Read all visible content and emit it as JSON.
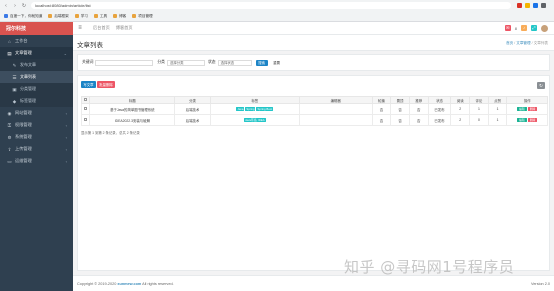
{
  "browser": {
    "url": "localhost:8080/admin/article/list",
    "bookmarks": [
      {
        "label": "百度一下，你就知道",
        "color": "#3b79e6"
      },
      {
        "label": "后端框架",
        "color": "#e8a33d"
      },
      {
        "label": "学习",
        "color": "#e8a33d"
      },
      {
        "label": "工具",
        "color": "#e8a33d"
      },
      {
        "label": "博客",
        "color": "#e8a33d"
      },
      {
        "label": "项目管理",
        "color": "#e8a33d"
      }
    ],
    "ext_colors": [
      "#d93025",
      "#f4b400",
      "#1a73e8",
      "#5f6368"
    ]
  },
  "sidebar": {
    "brand": "冠尔科技",
    "items": [
      {
        "label": "工作台",
        "icon": "home-icon",
        "glyph": "⌂"
      },
      {
        "label": "文章管理",
        "icon": "doc-icon",
        "glyph": "▤",
        "active": true
      },
      {
        "label": "发布文章",
        "icon": "edit-icon",
        "glyph": "✎",
        "sub": true
      },
      {
        "label": "文章列表",
        "icon": "list-icon",
        "glyph": "☰",
        "sub": true,
        "current": true
      },
      {
        "label": "分类管理",
        "icon": "folder-icon",
        "glyph": "▣",
        "sub": true
      },
      {
        "label": "标签管理",
        "icon": "tag-icon",
        "glyph": "◆",
        "sub": true
      },
      {
        "label": "网站管理",
        "icon": "globe-icon",
        "glyph": "◉"
      },
      {
        "label": "权限管理",
        "icon": "lock-icon",
        "glyph": "⚿"
      },
      {
        "label": "系统管理",
        "icon": "gear-icon",
        "glyph": "⚙"
      },
      {
        "label": "上传管理",
        "icon": "upload-icon",
        "glyph": "⇪"
      },
      {
        "label": "运维管理",
        "icon": "monitor-icon",
        "glyph": "▭"
      }
    ]
  },
  "topnav": {
    "tabs": [
      "后台首页",
      "博客首页"
    ],
    "badge_count": "8"
  },
  "page": {
    "title": "文章列表",
    "breadcrumb": [
      "首页",
      "文章管理",
      "文章列表"
    ]
  },
  "search": {
    "keyword_label": "关键词",
    "keyword_placeholder": "",
    "category_label": "分类",
    "category_value": "选择分类",
    "status_label": "状态",
    "status_value": "选择状态",
    "search_btn": "搜索",
    "reset_btn": "重置"
  },
  "toolbar": {
    "write_btn": "写文章",
    "batch_delete_btn": "批量删除"
  },
  "table": {
    "headers": [
      "",
      "标题",
      "分类",
      "标签",
      "编辑器",
      "轮播",
      "置顶",
      "推荐",
      "状态",
      "阅读",
      "评论",
      "点赞",
      "操作"
    ],
    "rows": [
      {
        "title": "基于Java的简单图书管理系统",
        "category": "后端技术",
        "tags": [
          "Java",
          "Spring",
          "Spring Boot"
        ],
        "editor": "",
        "carousel": "否",
        "top": "否",
        "recommend": "否",
        "status": "已发布",
        "reads": "2",
        "comments": "1",
        "likes": "1"
      },
      {
        "title": "IDEA2022.3安装与破解",
        "category": "后端技术",
        "tags": [
          "Java环境, IDEA"
        ],
        "editor": "",
        "carousel": "否",
        "top": "否",
        "recommend": "否",
        "status": "已发布",
        "reads": "2",
        "comments": "0",
        "likes": "1"
      }
    ],
    "edit_label": "编辑",
    "delete_label": "删除",
    "pager": "显示第 1 到第 2 条记录，总共 2 条记录"
  },
  "footer": {
    "copyright_prefix": "Copyright © 2019-2020",
    "site": "xunmew.com",
    "copyright_suffix": "All rights reserved.",
    "version": "Version 2.0"
  },
  "watermark": "知乎 @寻码网1号程序员",
  "colors": {
    "sidebar_bg": "#2f4050",
    "brand_bg": "#d9534f",
    "primary": "#1c84c6",
    "success": "#1ab394",
    "danger": "#ed5565",
    "info": "#23c6c8"
  }
}
